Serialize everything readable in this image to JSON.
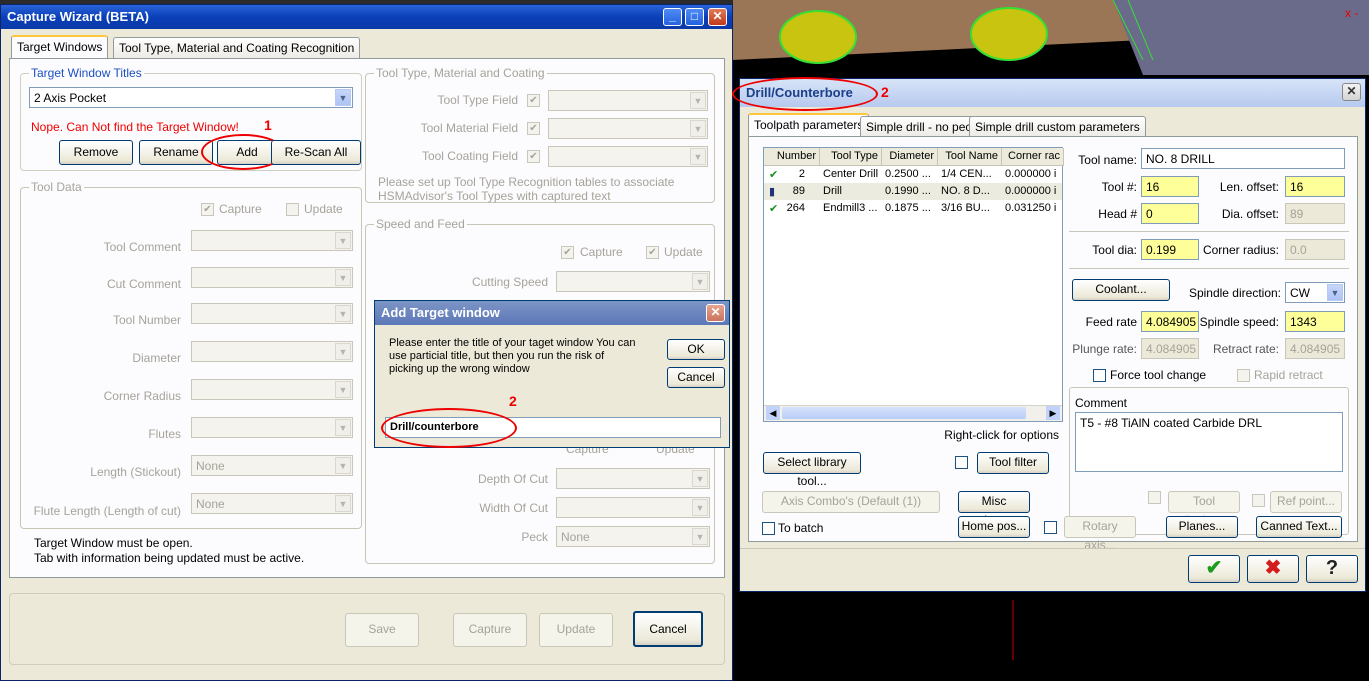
{
  "capture_wizard": {
    "title": "Capture Wizard (BETA)",
    "tabs": [
      "Target Windows",
      "Tool Type, Material and Coating Recognition"
    ],
    "target_window_titles_label": "Target Window Titles",
    "selected_title": "2 Axis Pocket",
    "error_text": "Nope. Can Not find the Target Window!",
    "buttons": {
      "remove": "Remove",
      "rename": "Rename",
      "add": "Add",
      "rescan": "Re-Scan All"
    },
    "annotation_1": "1",
    "tool_type_group": "Tool Type, Material and Coating",
    "tool_type_field": "Tool Type Field",
    "tool_material_field": "Tool Material Field",
    "tool_coating_field": "Tool Coating Field",
    "recognition_note": "Please set up Tool Type Recognition tables to associate HSMAdvisor's Tool Types with captured text",
    "tool_data_group": "Tool Data",
    "capture": "Capture",
    "update": "Update",
    "tool_data_fields": [
      "Tool Comment",
      "Cut Comment",
      "Tool Number",
      "Diameter",
      "Corner Radius",
      "Flutes",
      "Length (Stickout)",
      "Flute Length (Length of cut)"
    ],
    "none_value": "None",
    "speed_feed_group": "Speed and Feed",
    "cutting_speed": "Cutting Speed",
    "depth_of_cut": "Depth Of Cut",
    "width_of_cut": "Width Of Cut",
    "peck": "Peck",
    "hidden_capture": "Capture",
    "hidden_update": "Update",
    "footer_note_1": "Target Window must be open.",
    "footer_note_2": "Tab with information being updated must be active.",
    "bottom_buttons": {
      "save": "Save",
      "capture": "Capture",
      "update": "Update",
      "cancel": "Cancel"
    }
  },
  "add_target": {
    "title": "Add Target window",
    "instructions": "Please enter the title of your taget window You can use particial title, but then you run the risk of picking up the wrong window",
    "ok": "OK",
    "cancel": "Cancel",
    "annotation_2": "2",
    "input_value": "Drill/counterbore"
  },
  "drill": {
    "title": "Drill/Counterbore",
    "annotation_2": "2",
    "tabs": [
      "Toolpath parameters",
      "Simple drill - no peck",
      "Simple drill custom parameters"
    ],
    "columns": [
      "Number",
      "Tool Type",
      "Diameter",
      "Tool Name",
      "Corner rac"
    ],
    "rows": [
      {
        "number": "2",
        "type": "Center Drill",
        "diameter": "0.2500 ...",
        "name": "1/4 CEN...",
        "corner": "0.000000 i"
      },
      {
        "number": "89",
        "type": "Drill",
        "diameter": "0.1990 ...",
        "name": "NO. 8 D...",
        "corner": "0.000000 i"
      },
      {
        "number": "264",
        "type": "Endmill3 ...",
        "diameter": "0.1875 ...",
        "name": "3/16 BU...",
        "corner": "0.031250 i"
      }
    ],
    "tool_name_label": "Tool name:",
    "tool_name": "NO. 8 DRILL",
    "tool_num_label": "Tool #:",
    "tool_num": "16",
    "len_offset_label": "Len. offset:",
    "len_offset": "16",
    "head_label": "Head #",
    "head": "0",
    "dia_offset_label": "Dia. offset:",
    "dia_offset": "89",
    "tool_dia_label": "Tool dia:",
    "tool_dia": "0.199",
    "corner_radius_label": "Corner radius:",
    "corner_radius": "0.0",
    "coolant": "Coolant...",
    "spindle_dir_label": "Spindle direction:",
    "spindle_dir": "CW",
    "feed_rate_label": "Feed rate",
    "feed_rate": "4.084905",
    "spindle_speed_label": "Spindle speed:",
    "spindle_speed": "1343",
    "plunge_rate_label": "Plunge rate:",
    "plunge_rate": "4.084905",
    "retract_rate_label": "Retract rate:",
    "retract_rate": "4.084905",
    "force_tool_change": "Force tool change",
    "rapid_retract": "Rapid retract",
    "comment_label": "Comment",
    "comment": "T5 - #8 TiAlN coated Carbide DRL",
    "right_click": "Right-click for options",
    "select_library": "Select library tool...",
    "tool_filter": "Tool filter",
    "axis_combo": "Axis Combo's (Default (1))",
    "misc_values": "Misc values...",
    "tool_display": "Tool display...",
    "ref_point": "Ref point...",
    "to_batch": "To batch",
    "home_pos": "Home pos...",
    "rotary_axis": "Rotary axis...",
    "planes": "Planes...",
    "canned_text": "Canned Text...",
    "ok_icon": "✔",
    "cancel_icon": "✖",
    "help_icon": "?"
  },
  "cad": {
    "corner_mark": "x -"
  }
}
